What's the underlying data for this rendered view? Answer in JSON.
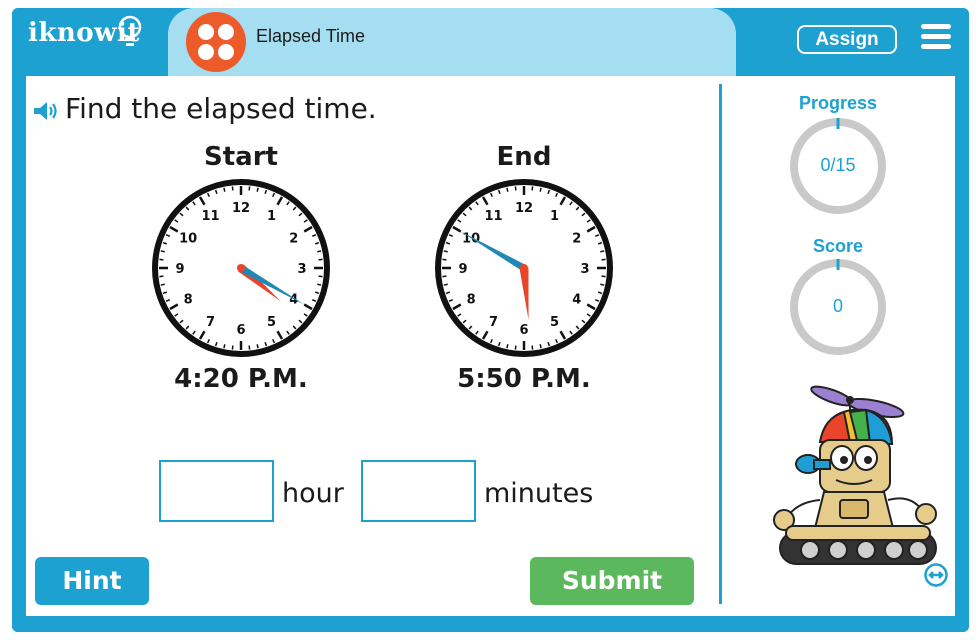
{
  "header": {
    "logo_text": "iknowit",
    "title": "Elapsed Time",
    "assign_label": "Assign",
    "menu_icon": "hamburger-menu-icon",
    "accent_color": "#1da1d1",
    "title_tab_color": "#a4def0",
    "title_icon_color": "#ee5b2b"
  },
  "question": {
    "text": "Find the elapsed time.",
    "audio_icon": "speaker-icon"
  },
  "clocks": {
    "start": {
      "label": "Start",
      "time_text": "4:20 P.M.",
      "hour": 4,
      "minute": 20
    },
    "end": {
      "label": "End",
      "time_text": "5:50 P.M.",
      "hour": 5,
      "minute": 50
    },
    "numbers": [
      "12",
      "1",
      "2",
      "3",
      "4",
      "5",
      "6",
      "7",
      "8",
      "9",
      "10",
      "11"
    ],
    "hour_hand_color": "#e8452b",
    "minute_hand_color": "#1f88b5"
  },
  "answer": {
    "hour_value": "",
    "hour_label": "hour",
    "minutes_value": "",
    "minutes_label": "minutes"
  },
  "buttons": {
    "hint_label": "Hint",
    "submit_label": "Submit",
    "hint_color": "#1da1d1",
    "submit_color": "#5cb85c"
  },
  "sidebar": {
    "progress_label": "Progress",
    "progress_value": "0/15",
    "progress_fraction": 0,
    "score_label": "Score",
    "score_value": "0",
    "resize_icon": "resize-arrows-icon"
  }
}
